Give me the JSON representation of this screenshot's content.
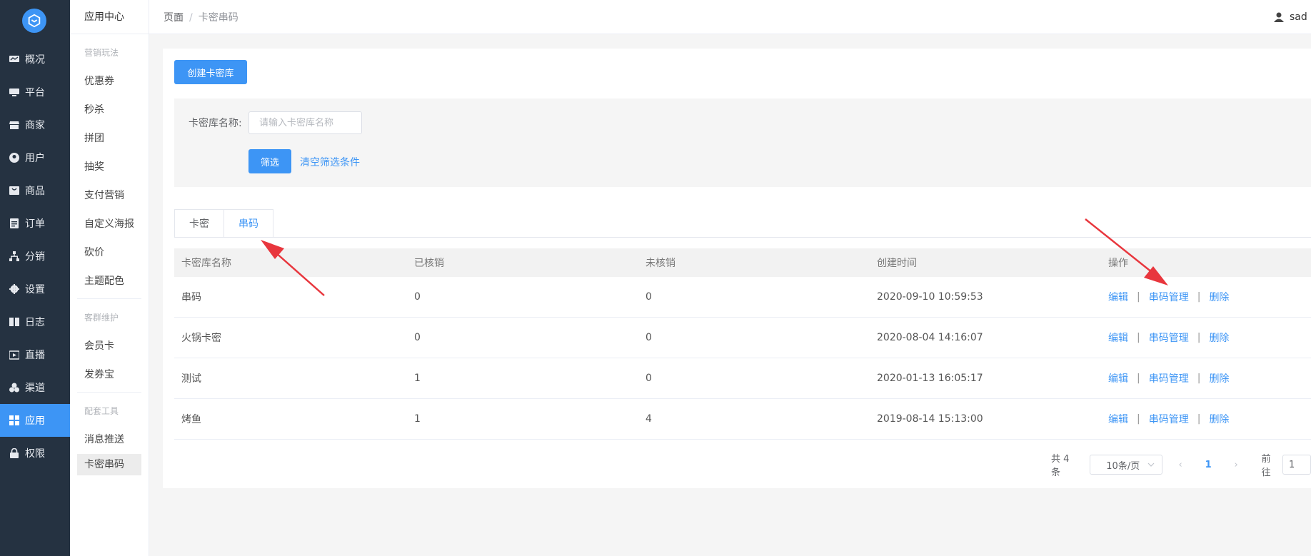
{
  "nav": {
    "items": [
      {
        "label": "概况",
        "icon": "chart-icon"
      },
      {
        "label": "平台",
        "icon": "monitor-icon"
      },
      {
        "label": "商家",
        "icon": "store-icon"
      },
      {
        "label": "用户",
        "icon": "user-icon"
      },
      {
        "label": "商品",
        "icon": "goods-icon"
      },
      {
        "label": "订单",
        "icon": "order-icon"
      },
      {
        "label": "分销",
        "icon": "share-icon"
      },
      {
        "label": "设置",
        "icon": "gear-icon"
      },
      {
        "label": "日志",
        "icon": "book-icon"
      },
      {
        "label": "直播",
        "icon": "live-icon"
      },
      {
        "label": "渠道",
        "icon": "channel-icon"
      },
      {
        "label": "应用",
        "icon": "grid-icon"
      },
      {
        "label": "权限",
        "icon": "lock-icon"
      }
    ]
  },
  "subnav": {
    "title": "应用中心",
    "group1": "营销玩法",
    "group1_items": [
      "优惠券",
      "秒杀",
      "拼团",
      "抽奖",
      "支付营销",
      "自定义海报",
      "砍价",
      "主题配色"
    ],
    "group2": "客群维护",
    "group2_items": [
      "会员卡",
      "发券宝"
    ],
    "group3": "配套工具",
    "group3_items": [
      "消息推送",
      "卡密串码"
    ]
  },
  "header": {
    "crumb_root": "页面",
    "crumb_sep": "/",
    "crumb_current": "卡密串码",
    "user_name": "sad"
  },
  "main": {
    "create_label": "创建卡密库",
    "filter_label": "卡密库名称:",
    "filter_placeholder": "请输入卡密库名称",
    "filter_button": "筛选",
    "clear_link": "清空筛选条件",
    "tabs": [
      "卡密",
      "串码"
    ],
    "columns": [
      "卡密库名称",
      "已核销",
      "未核销",
      "创建时间",
      "操作"
    ],
    "rows": [
      {
        "name": "串码",
        "used": "0",
        "unused": "0",
        "created": "2020-09-10 10:59:53"
      },
      {
        "name": "火锅卡密",
        "used": "0",
        "unused": "0",
        "created": "2020-08-04 14:16:07"
      },
      {
        "name": "测试",
        "used": "1",
        "unused": "0",
        "created": "2020-01-13 16:05:17"
      },
      {
        "name": "烤鱼",
        "used": "1",
        "unused": "4",
        "created": "2019-08-14 15:13:00"
      }
    ],
    "actions": {
      "edit": "编辑",
      "manage": "串码管理",
      "delete": "删除",
      "sep": "|"
    }
  },
  "pager": {
    "total": "共 4 条",
    "page_size": "10条/页",
    "prev": "‹",
    "current": "1",
    "next": "›",
    "goto_label": "前往",
    "goto_value": "1"
  },
  "colors": {
    "accent": "#3d95f5",
    "sidebar": "#253241",
    "annotation_arrow": "#e8363d"
  }
}
